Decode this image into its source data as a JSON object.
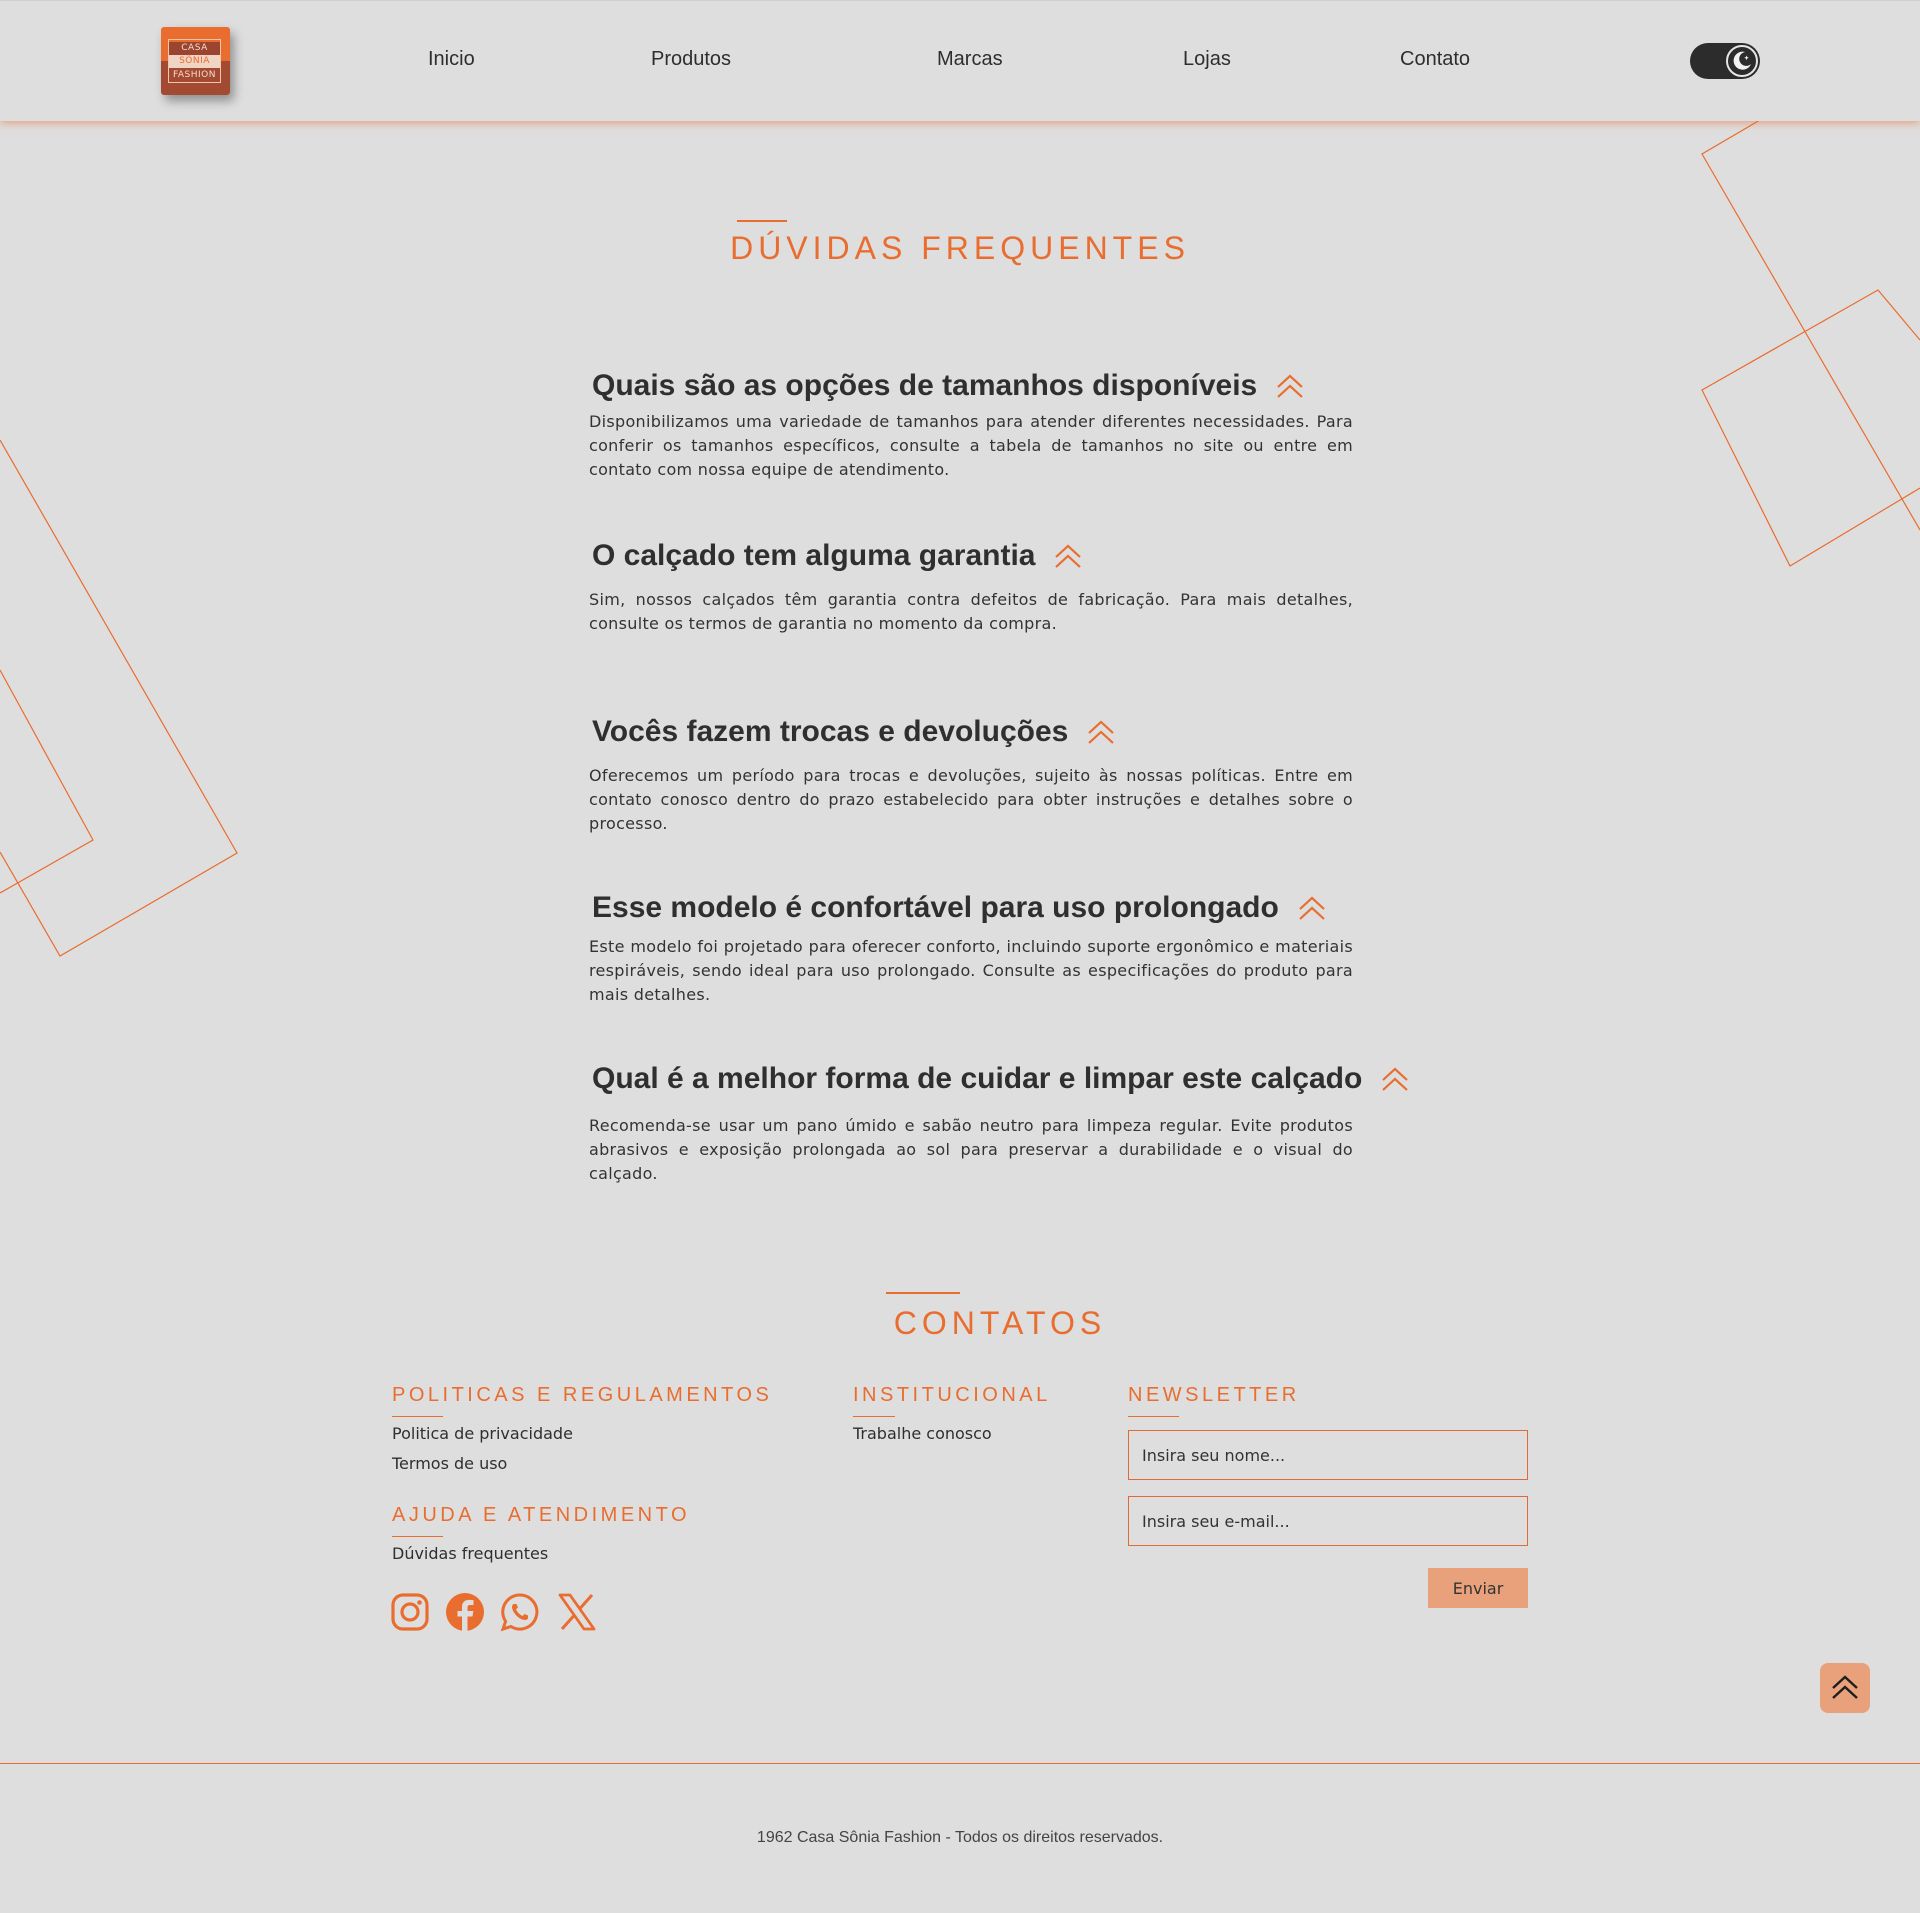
{
  "header": {
    "logo": {
      "line1": "CASA",
      "line2": "SÔNIA",
      "line3": "FASHION"
    },
    "nav": [
      "Inicio",
      "Produtos",
      "Marcas",
      "Lojas",
      "Contato"
    ],
    "theme_toggle_icon": "moon-icon"
  },
  "faq": {
    "title": "DÚVIDAS FREQUENTES",
    "items": [
      {
        "question": "Quais são as opções de tamanhos disponíveis",
        "answer": "Disponibilizamos uma variedade de tamanhos para atender diferentes necessidades. Para conferir os tamanhos específicos, consulte a tabela de tamanhos no site ou entre em contato com nossa equipe de atendimento."
      },
      {
        "question": "O calçado tem alguma garantia",
        "answer": "Sim, nossos calçados têm garantia contra defeitos de fabricação. Para mais detalhes, consulte os termos de garantia no momento da compra."
      },
      {
        "question": "Vocês fazem trocas e devoluções",
        "answer": "Oferecemos um período para trocas e devoluções, sujeito às nossas políticas. Entre em contato conosco dentro do prazo estabelecido para obter instruções e detalhes sobre o processo."
      },
      {
        "question": "Esse modelo é confortável para uso prolongado",
        "answer": "Este modelo foi projetado para oferecer conforto, incluindo suporte ergonômico e materiais respiráveis, sendo ideal para uso prolongado. Consulte as especificações do produto para mais detalhes."
      },
      {
        "question": "Qual é a melhor forma de cuidar e limpar este calçado",
        "answer": "Recomenda-se usar um pano úmido e sabão neutro para limpeza regular. Evite produtos abrasivos e exposição prolongada ao sol para preservar a durabilidade e o visual do calçado."
      }
    ]
  },
  "contacts": {
    "title": "CONTATOS",
    "policies": {
      "heading": "POLITICAS E REGULAMENTOS",
      "links": [
        "Politica de privacidade",
        "Termos de uso"
      ]
    },
    "help": {
      "heading": "AJUDA E ATENDIMENTO",
      "links": [
        "Dúvidas frequentes"
      ]
    },
    "institutional": {
      "heading": "INSTITUCIONAL",
      "links": [
        "Trabalhe conosco"
      ]
    },
    "newsletter": {
      "heading": "NEWSLETTER",
      "name_placeholder": "Insira seu nome...",
      "email_placeholder": "Insira seu e-mail...",
      "submit_label": "Enviar"
    },
    "social": [
      "instagram-icon",
      "facebook-icon",
      "whatsapp-icon",
      "x-icon"
    ]
  },
  "footer": {
    "copyright": "1962 Casa Sônia Fashion - Todos os direitos reservados."
  },
  "colors": {
    "accent": "#e96d2e",
    "background": "#dedede",
    "button": "#e9a17b",
    "text": "#333333"
  }
}
